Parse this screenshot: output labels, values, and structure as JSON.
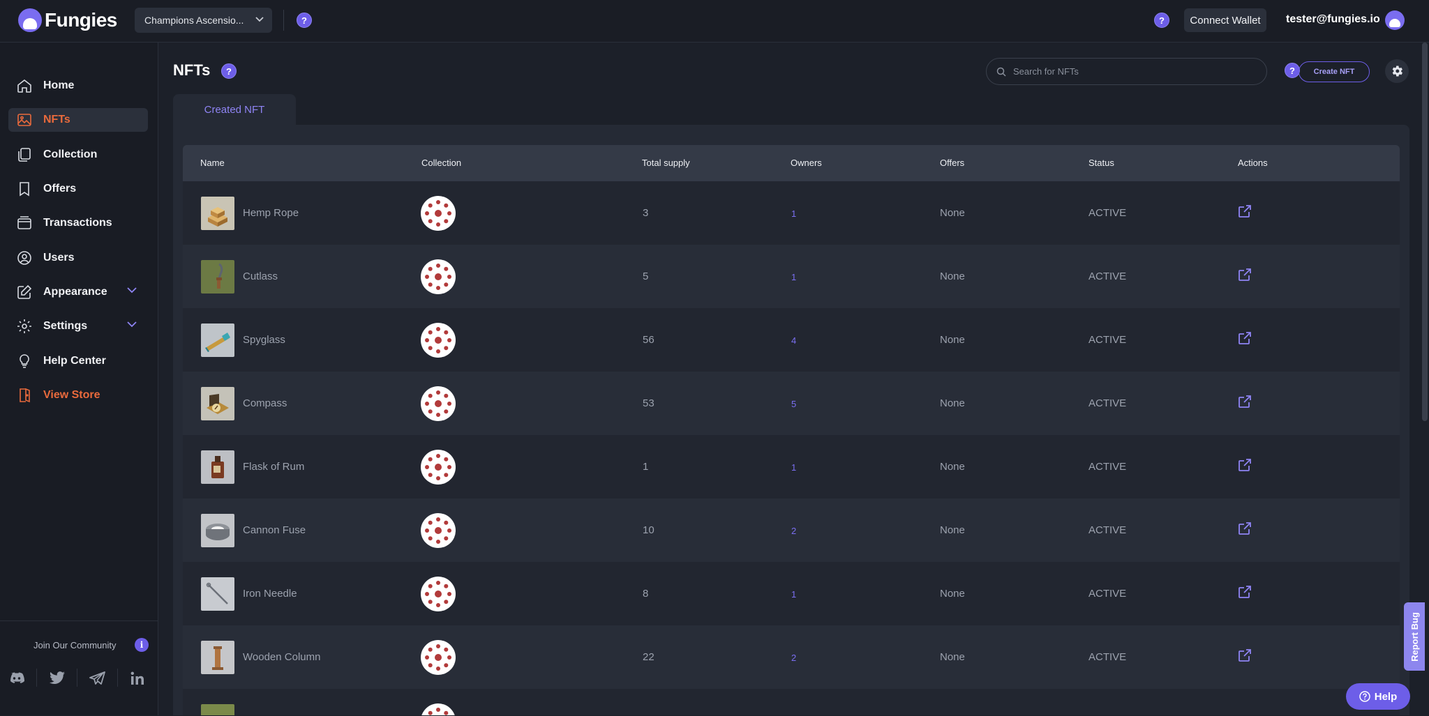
{
  "app": {
    "brand": "Fungies",
    "accent": "#6d5ee8",
    "highlight": "#e96a3c"
  },
  "topbar": {
    "store_selector": "Champions Ascensio...",
    "connect_wallet": "Connect Wallet",
    "user_email": "tester@fungies.io"
  },
  "sidebar": {
    "items": [
      {
        "label": "Home",
        "icon": "home-icon"
      },
      {
        "label": "NFTs",
        "icon": "image-icon",
        "active": true
      },
      {
        "label": "Collection",
        "icon": "collection-icon"
      },
      {
        "label": "Offers",
        "icon": "bookmark-icon"
      },
      {
        "label": "Transactions",
        "icon": "wallet-icon"
      },
      {
        "label": "Users",
        "icon": "user-icon"
      },
      {
        "label": "Appearance",
        "icon": "edit-icon",
        "expandable": true
      },
      {
        "label": "Settings",
        "icon": "gear-icon",
        "expandable": true
      },
      {
        "label": "Help Center",
        "icon": "lightbulb-icon"
      },
      {
        "label": "View Store",
        "icon": "door-icon"
      }
    ],
    "community": {
      "label": "Join Our Community",
      "socials": [
        "discord-icon",
        "twitter-icon",
        "telegram-icon",
        "linkedin-icon"
      ]
    }
  },
  "main": {
    "title": "NFTs",
    "search_placeholder": "Search for NFTs",
    "create_button": "Create NFT",
    "tabs": [
      {
        "label": "Created NFT",
        "active": true
      }
    ]
  },
  "table": {
    "columns": [
      "Name",
      "Collection",
      "Total supply",
      "Owners",
      "Offers",
      "Status",
      "Actions"
    ],
    "rows": [
      {
        "name": "Hemp Rope",
        "supply": "3",
        "owners": "1",
        "offers": "None",
        "status": "ACTIVE"
      },
      {
        "name": "Cutlass",
        "supply": "5",
        "owners": "1",
        "offers": "None",
        "status": "ACTIVE"
      },
      {
        "name": "Spyglass",
        "supply": "56",
        "owners": "4",
        "offers": "None",
        "status": "ACTIVE"
      },
      {
        "name": "Compass",
        "supply": "53",
        "owners": "5",
        "offers": "None",
        "status": "ACTIVE"
      },
      {
        "name": "Flask of Rum",
        "supply": "1",
        "owners": "1",
        "offers": "None",
        "status": "ACTIVE"
      },
      {
        "name": "Cannon Fuse",
        "supply": "10",
        "owners": "2",
        "offers": "None",
        "status": "ACTIVE"
      },
      {
        "name": "Iron Needle",
        "supply": "8",
        "owners": "1",
        "offers": "None",
        "status": "ACTIVE"
      },
      {
        "name": "Wooden Column",
        "supply": "22",
        "owners": "2",
        "offers": "None",
        "status": "ACTIVE"
      }
    ]
  },
  "floating": {
    "report_bug": "Report Bug",
    "help": "Help"
  }
}
